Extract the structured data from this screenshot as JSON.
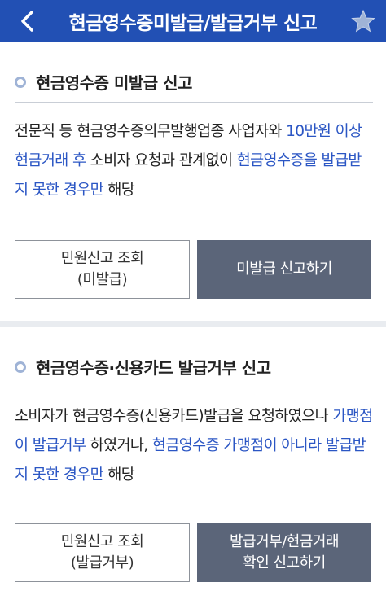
{
  "header": {
    "title": "현금영수증미발급/발급거부 신고",
    "back_icon": "chevron-left-icon",
    "star_icon": "star-icon",
    "bg_color": "#2250b4"
  },
  "section1": {
    "title": "현금영수증 미발급 신고",
    "desc": {
      "t1": "전문직 등 현금영수증의무발행업종 사업자와 ",
      "h1": "10만원 이상 현금거래 후",
      "t2": " 소비자 요청과 관계없이 ",
      "h2": "현금영수증을 발급받지 못한 경우만",
      "t3": " 해당"
    },
    "btn_lookup_line1": "민원신고 조회",
    "btn_lookup_line2": "(미발급)",
    "btn_report": "미발급 신고하기"
  },
  "section2": {
    "title": "현금영수증·신용카드 발급거부 신고",
    "desc": {
      "t1": "소비자가 현금영수증(신용카드)발급을 요청하였으나 ",
      "h1": "가맹점이 발급거부",
      "t2": " 하였거나, ",
      "h2": "현금영수증 가맹점이 아니라 발급받지 못한 경우만",
      "t3": " 해당"
    },
    "btn_lookup_line1": "민원신고 조회",
    "btn_lookup_line2": "(발급거부)",
    "btn_report_line1": "발급거부/현금거래",
    "btn_report_line2": "확인 신고하기"
  },
  "colors": {
    "highlight": "#2b56c4",
    "solid_button": "#5b6579"
  }
}
